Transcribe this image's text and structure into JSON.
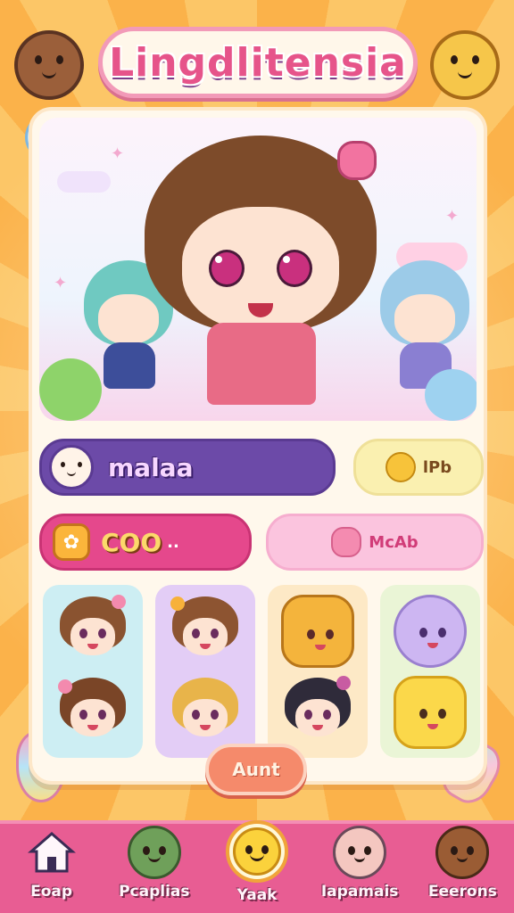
{
  "app": {
    "title": "Lingdlitensia"
  },
  "profile": {
    "name": "malaa",
    "level": "lPb",
    "coins": "COO",
    "coins_suffix": "..",
    "rank": "McAb"
  },
  "action_button": {
    "label": "Aunt"
  },
  "nav": {
    "items": [
      {
        "label": "Eoap",
        "icon": "home-icon"
      },
      {
        "label": "Pcaplias",
        "icon": "frog-icon"
      },
      {
        "label": "Yaak",
        "icon": "smiley-icon",
        "active": true
      },
      {
        "label": "Iapamais",
        "icon": "mouse-icon"
      },
      {
        "label": "Eeerons",
        "icon": "bear-icon"
      }
    ]
  },
  "stickers": [
    [
      "brown-hair-girl",
      "brown-hair-girl-2"
    ],
    [
      "brown-hair-girl-3",
      "blonde-cat-girl"
    ],
    [
      "orange-cat",
      "dark-hair-girl"
    ],
    [
      "purple-ghost",
      "yellow-chick"
    ]
  ],
  "colors": {
    "accent_pink": "#e85d93",
    "purple": "#6c4aa8",
    "coin_pink": "#e5488c",
    "background_orange": "#fbb24a"
  }
}
